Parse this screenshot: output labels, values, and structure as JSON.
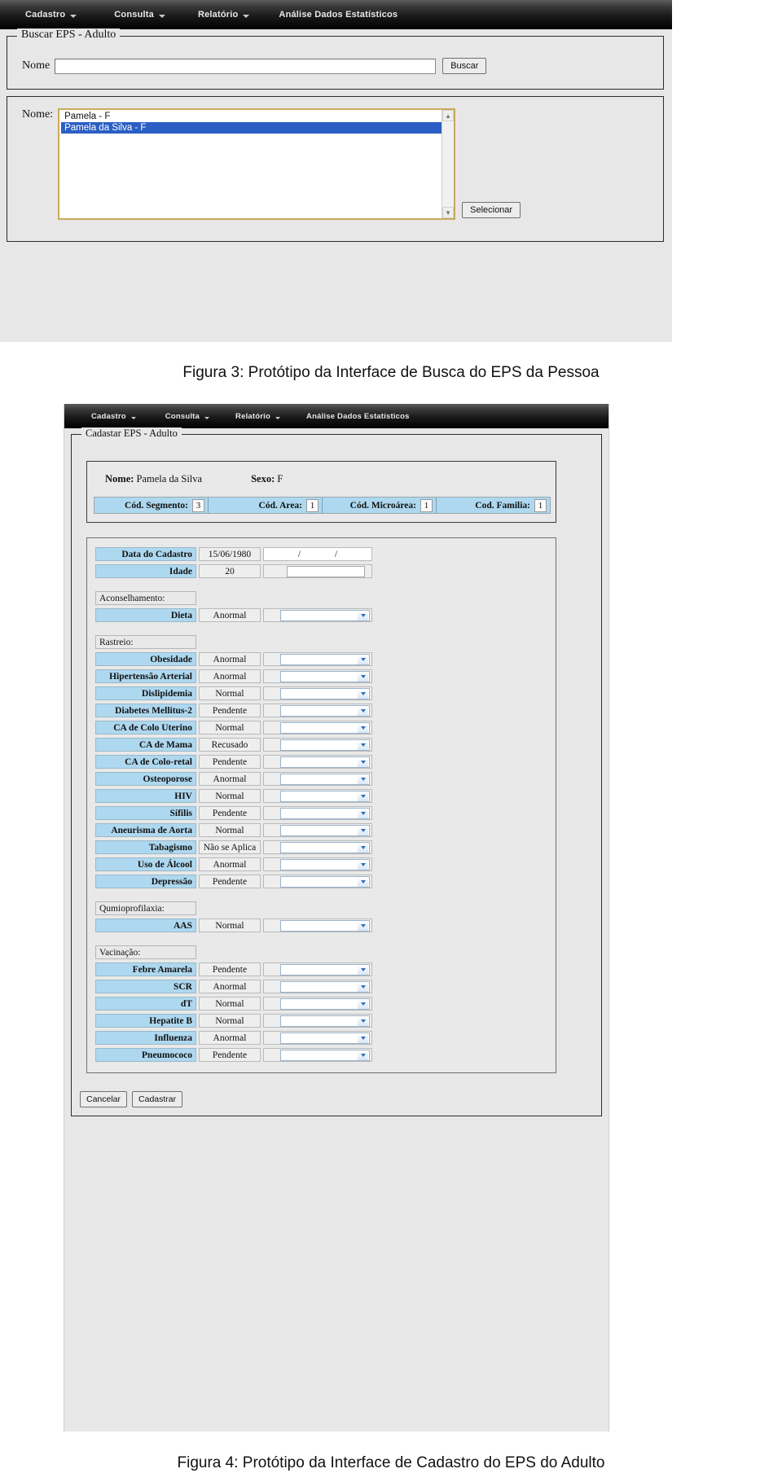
{
  "menu": {
    "items": [
      {
        "label": "Cadastro",
        "has_caret": true
      },
      {
        "label": "Consulta",
        "has_caret": true
      },
      {
        "label": "Relatório",
        "has_caret": true
      },
      {
        "label": "Análise Dados Estatísticos",
        "has_caret": false
      }
    ]
  },
  "figure3": {
    "search_group_legend": "Buscar EPS - Adulto",
    "name_label": "Nome",
    "name_value": "",
    "name_placeholder": "",
    "search_button": "Buscar",
    "result_label": "Nome:",
    "results": [
      {
        "text": "Pamela - F",
        "selected": false
      },
      {
        "text": "Pamela da Silva - F",
        "selected": true
      }
    ],
    "select_button": "Selecionar",
    "scroll_up": "▲",
    "scroll_down": "▼",
    "selection_color": "#2b5fc4"
  },
  "figure3_caption": "Figura 3: Protótipo da Interface de Busca do EPS da Pessoa",
  "figure4": {
    "group_legend": "Cadastar EPS - Adulto",
    "patient": {
      "name_label": "Nome:",
      "name_value": "Pamela da Silva",
      "sex_label": "Sexo:",
      "sex_value": "F"
    },
    "codes": [
      {
        "label": "Cód. Segmento:",
        "value": "3"
      },
      {
        "label": "Cód. Area:",
        "value": "1"
      },
      {
        "label": "Cód. Microárea:",
        "value": "1"
      },
      {
        "label": "Cod. Familia:",
        "value": "1"
      }
    ],
    "rows": [
      {
        "kind": "date",
        "name": "Data do Cadastro",
        "value": "15/06/1980"
      },
      {
        "kind": "age",
        "name": "Idade",
        "value": "20"
      },
      {
        "kind": "spacer"
      },
      {
        "kind": "section",
        "name": "Aconselhamento:"
      },
      {
        "kind": "field",
        "name": "Dieta",
        "value": "Anormal"
      },
      {
        "kind": "spacer"
      },
      {
        "kind": "section",
        "name": "Rastreio:"
      },
      {
        "kind": "field",
        "name": "Obesidade",
        "value": "Anormal"
      },
      {
        "kind": "field",
        "name": "Hipertensão Arterial",
        "value": "Anormal"
      },
      {
        "kind": "field",
        "name": "Dislipidemia",
        "value": "Normal"
      },
      {
        "kind": "field",
        "name": "Diabetes Mellitus-2",
        "value": "Pendente"
      },
      {
        "kind": "field",
        "name": "CA de Colo Uterino",
        "value": "Normal"
      },
      {
        "kind": "field",
        "name": "CA de Mama",
        "value": "Recusado"
      },
      {
        "kind": "field",
        "name": "CA de Colo-retal",
        "value": "Pendente"
      },
      {
        "kind": "field",
        "name": "Osteoporose",
        "value": "Anormal"
      },
      {
        "kind": "field",
        "name": "HIV",
        "value": "Normal"
      },
      {
        "kind": "field",
        "name": "Sífilis",
        "value": "Pendente"
      },
      {
        "kind": "field",
        "name": "Aneurisma de Aorta",
        "value": "Normal"
      },
      {
        "kind": "field",
        "name": "Tabagismo",
        "value": "Não se Aplica"
      },
      {
        "kind": "field",
        "name": "Uso de Álcool",
        "value": "Anormal"
      },
      {
        "kind": "field",
        "name": "Depressão",
        "value": "Pendente"
      },
      {
        "kind": "spacer"
      },
      {
        "kind": "section",
        "name": "Qumioprofilaxia:"
      },
      {
        "kind": "field",
        "name": "AAS",
        "value": "Normal"
      },
      {
        "kind": "spacer"
      },
      {
        "kind": "section",
        "name": "Vacinação:"
      },
      {
        "kind": "field",
        "name": "Febre Amarela",
        "value": "Pendente"
      },
      {
        "kind": "field",
        "name": "SCR",
        "value": "Anormal"
      },
      {
        "kind": "field",
        "name": "dT",
        "value": "Normal"
      },
      {
        "kind": "field",
        "name": "Hepatite B",
        "value": "Normal"
      },
      {
        "kind": "field",
        "name": "Influenza",
        "value": "Anormal"
      },
      {
        "kind": "field",
        "name": "Pneumococo",
        "value": "Pendente"
      }
    ],
    "buttons": {
      "cancel": "Cancelar",
      "submit": "Cadastrar"
    },
    "colors": {
      "label_blue": "#aed8ef",
      "panel_gray": "#e9e9e9",
      "combo_arrow": "#2a6fbb"
    }
  },
  "figure4_caption": "Figura 4: Protótipo da Interface de Cadastro do EPS do Adulto"
}
